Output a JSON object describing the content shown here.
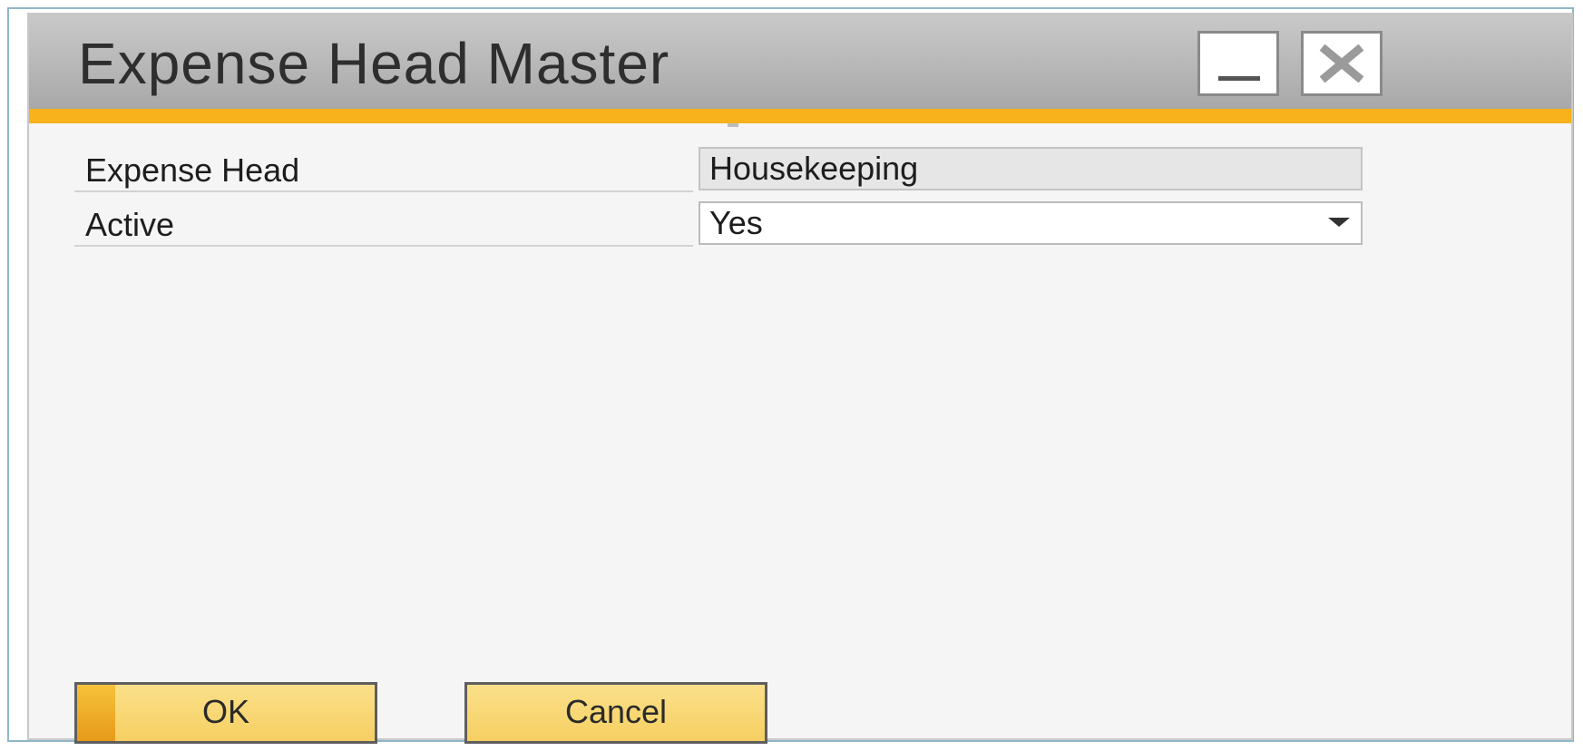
{
  "window": {
    "title": "Expense Head Master",
    "controls": {
      "minimize_icon": "minimize-icon",
      "close_icon": "close-icon"
    },
    "colors": {
      "accent": "#f7b21c",
      "titlebar": "#b9b9b9",
      "button_fill": "#f6cf62"
    }
  },
  "form": {
    "fields": [
      {
        "label": "Expense Head",
        "value": "Housekeeping"
      },
      {
        "label": "Active",
        "value": "Yes"
      }
    ]
  },
  "footer": {
    "ok_label": "OK",
    "cancel_label": "Cancel"
  }
}
